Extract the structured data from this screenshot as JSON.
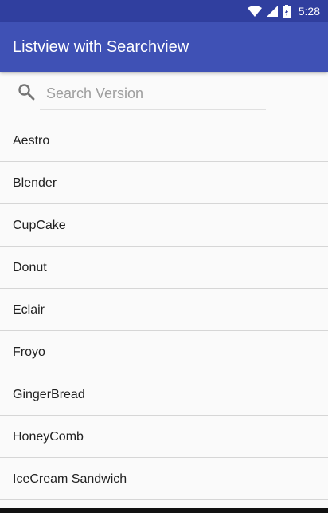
{
  "status_bar": {
    "time": "5:28",
    "icons": [
      "wifi-icon",
      "signal-icon",
      "battery-icon"
    ],
    "color": "#303f9f"
  },
  "app_bar": {
    "title": "Listview with Searchview",
    "color": "#3f51b5"
  },
  "search": {
    "placeholder": "Search Version",
    "value": "",
    "icon": "search-icon"
  },
  "list": {
    "items": [
      "Aestro",
      "Blender",
      "CupCake",
      "Donut",
      "Eclair",
      "Froyo",
      "GingerBread",
      "HoneyComb",
      "IceCream Sandwich"
    ]
  }
}
